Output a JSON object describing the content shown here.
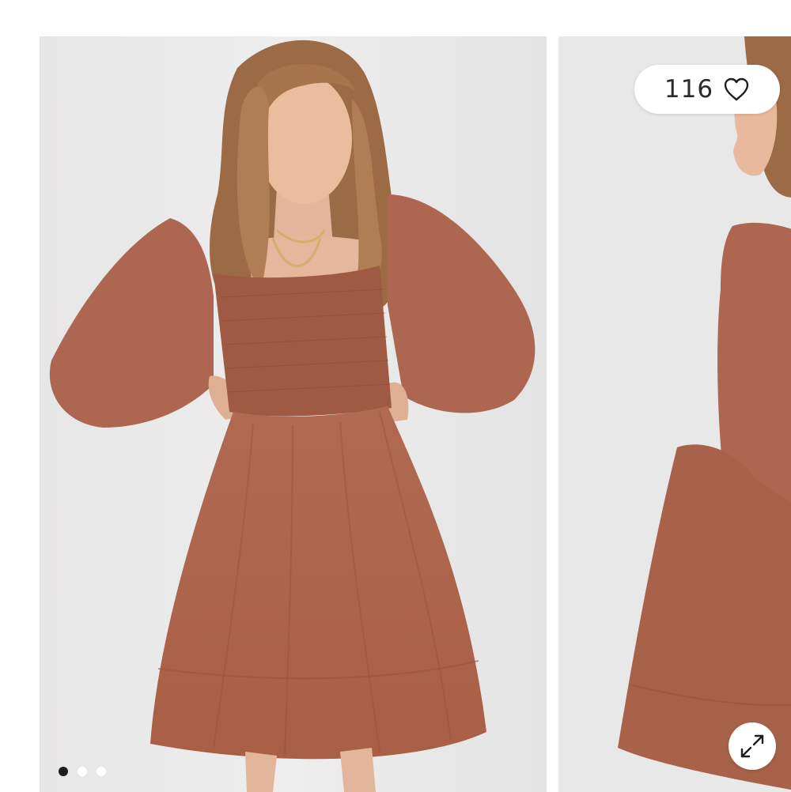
{
  "gallery": {
    "slides": [
      {
        "description_name": "product-photo-front"
      },
      {
        "description_name": "product-photo-side"
      }
    ],
    "active_index": 0,
    "dot_count": 3
  },
  "favorites": {
    "count": "116",
    "icon": "heart-outline-icon"
  },
  "expand": {
    "icon": "expand-arrows-icon"
  },
  "colors": {
    "dress": "#b46c53",
    "backdrop": "#ecebeb",
    "dot_active": "#1c1c1c",
    "dot_inactive": "#ffffff"
  }
}
